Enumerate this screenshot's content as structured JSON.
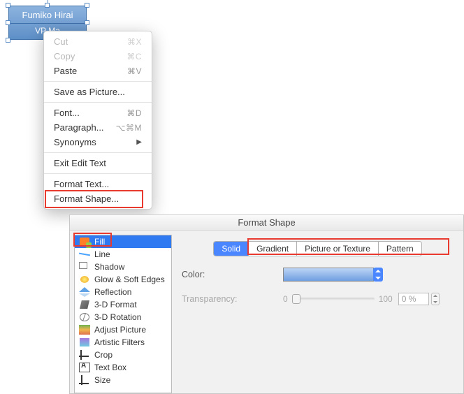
{
  "shape": {
    "name": "Fumiko Hirai",
    "role_visible": "VP Ma"
  },
  "context_menu": {
    "cut": {
      "label": "Cut",
      "key": "⌘X"
    },
    "copy": {
      "label": "Copy",
      "key": "⌘C"
    },
    "paste": {
      "label": "Paste",
      "key": "⌘V"
    },
    "save_pic": {
      "label": "Save as Picture..."
    },
    "font": {
      "label": "Font...",
      "key": "⌘D"
    },
    "paragraph": {
      "label": "Paragraph...",
      "key": "⌥⌘M"
    },
    "synonyms": {
      "label": "Synonyms"
    },
    "exit_edit": {
      "label": "Exit Edit Text"
    },
    "fmt_text": {
      "label": "Format Text..."
    },
    "fmt_shape": {
      "label": "Format Shape..."
    }
  },
  "window": {
    "title": "Format Shape"
  },
  "sidebar": [
    {
      "id": "fill",
      "label": "Fill"
    },
    {
      "id": "line",
      "label": "Line"
    },
    {
      "id": "shadow",
      "label": "Shadow"
    },
    {
      "id": "glow",
      "label": "Glow & Soft Edges"
    },
    {
      "id": "reflection",
      "label": "Reflection"
    },
    {
      "id": "format3d",
      "label": "3-D Format"
    },
    {
      "id": "rotation3d",
      "label": "3-D Rotation"
    },
    {
      "id": "adjpic",
      "label": "Adjust Picture"
    },
    {
      "id": "artistic",
      "label": "Artistic Filters"
    },
    {
      "id": "crop",
      "label": "Crop"
    },
    {
      "id": "textbox",
      "label": "Text Box"
    },
    {
      "id": "size",
      "label": "Size"
    }
  ],
  "fill_tabs": {
    "solid": "Solid",
    "gradient": "Gradient",
    "picture": "Picture or Texture",
    "pattern": "Pattern"
  },
  "panel": {
    "color_label": "Color:",
    "transparency_label": "Transparency:",
    "trans_min": "0",
    "trans_max": "100",
    "trans_value": "0 %"
  }
}
